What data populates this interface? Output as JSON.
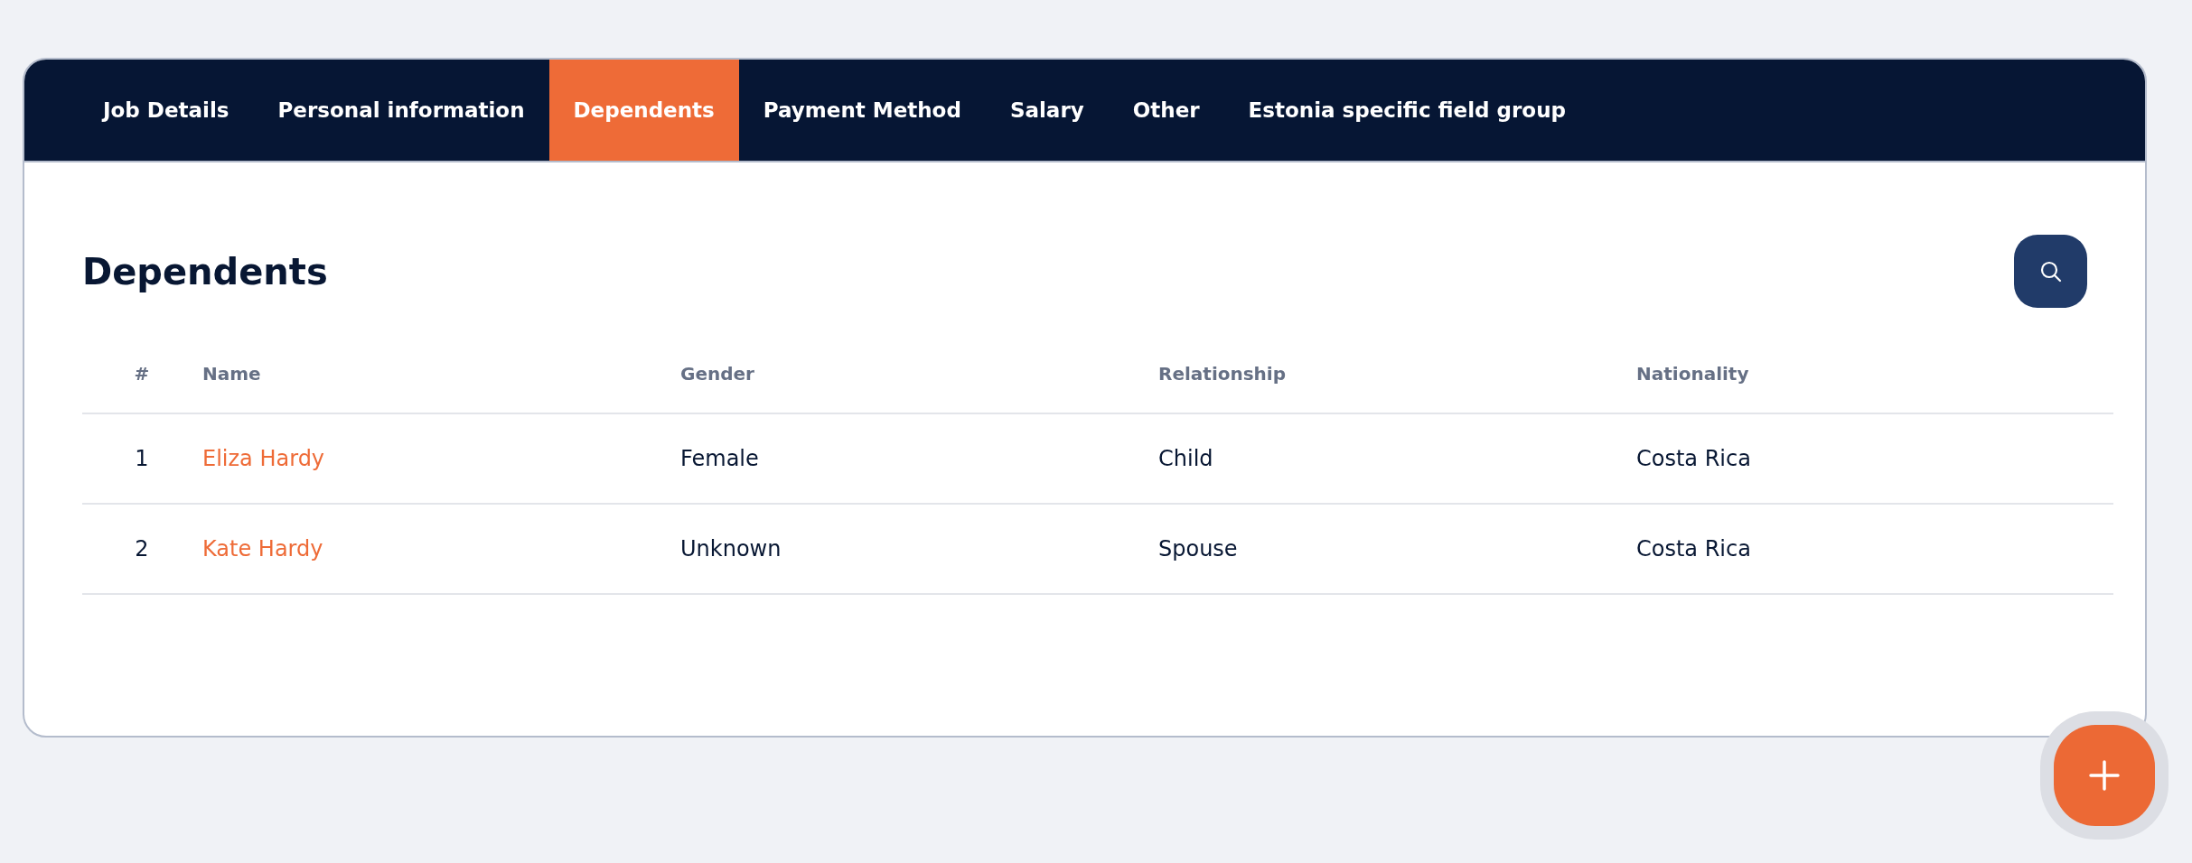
{
  "tabs": [
    {
      "label": "Job Details",
      "selected": false
    },
    {
      "label": "Personal information",
      "selected": false
    },
    {
      "label": "Dependents",
      "selected": true
    },
    {
      "label": "Payment Method",
      "selected": false
    },
    {
      "label": "Salary",
      "selected": false
    },
    {
      "label": "Other",
      "selected": false
    },
    {
      "label": "Estonia specific field group",
      "selected": false
    }
  ],
  "section": {
    "title": "Dependents"
  },
  "table": {
    "columns": [
      "#",
      "Name",
      "Gender",
      "Relationship",
      "Nationality"
    ],
    "rows": [
      {
        "index": "1",
        "name": "Eliza Hardy",
        "gender": "Female",
        "relationship": "Child",
        "nationality": "Costa Rica"
      },
      {
        "index": "2",
        "name": "Kate Hardy",
        "gender": "Unknown",
        "relationship": "Spouse",
        "nationality": "Costa Rica"
      }
    ]
  }
}
